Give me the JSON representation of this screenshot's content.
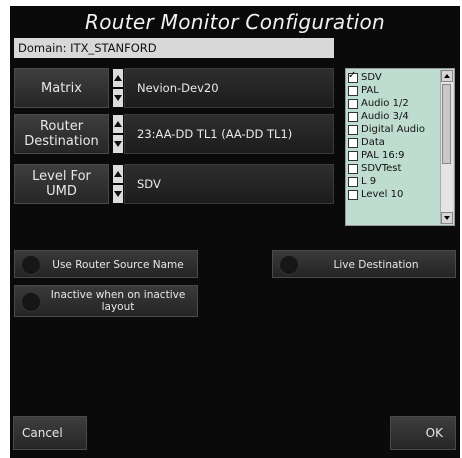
{
  "title": "Router Monitor Configuration",
  "domain": "Domain: ITX_STANFORD",
  "rows": [
    {
      "label": "Matrix",
      "value": "Nevion-Dev20"
    },
    {
      "label_line1": "Router",
      "label_line2": "Destination",
      "value": "23:AA-DD TL1 (AA-DD TL1)"
    },
    {
      "label_line1": "Level For",
      "label_line2": "UMD",
      "value": "SDV"
    }
  ],
  "levels": [
    {
      "label": "SDV",
      "checked": true
    },
    {
      "label": "PAL",
      "checked": false
    },
    {
      "label": "Audio 1/2",
      "checked": false
    },
    {
      "label": "Audio 3/4",
      "checked": false
    },
    {
      "label": "Digital Audio",
      "checked": false
    },
    {
      "label": "Data",
      "checked": false
    },
    {
      "label": "PAL 16:9",
      "checked": false
    },
    {
      "label": "SDVTest",
      "checked": false
    },
    {
      "label": "L 9",
      "checked": false
    },
    {
      "label": "Level 10",
      "checked": false
    }
  ],
  "toggles": {
    "use_router_source_name": "Use Router Source Name",
    "live_destination": "Live Destination",
    "inactive_line1": "Inactive when on inactive",
    "inactive_line2": "layout"
  },
  "buttons": {
    "cancel": "Cancel",
    "ok": "OK"
  }
}
